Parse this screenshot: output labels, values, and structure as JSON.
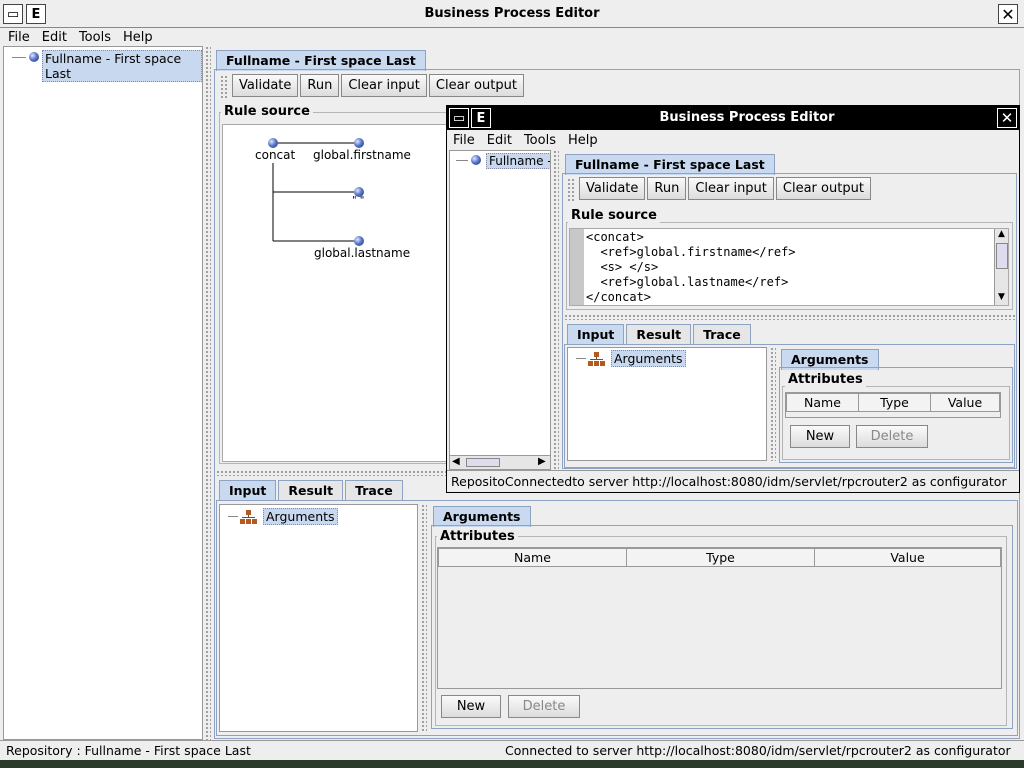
{
  "main": {
    "title": "Business Process Editor",
    "menu": [
      {
        "label": "File"
      },
      {
        "label": "Edit"
      },
      {
        "label": "Tools"
      },
      {
        "label": "Help"
      }
    ],
    "tree_root": "Fullname - First space Last",
    "doc_tab": "Fullname - First space Last",
    "toolbar": {
      "validate": "Validate",
      "run": "Run",
      "clear_input": "Clear input",
      "clear_output": "Clear output"
    },
    "rule_source_title": "Rule source",
    "diagram": {
      "root": "concat",
      "children": [
        "global.firstname",
        "\" \"",
        "global.lastname"
      ]
    },
    "io_tabs": [
      "Input",
      "Result",
      "Trace"
    ],
    "args_tree": "Arguments",
    "args_tab": "Arguments",
    "attributes_title": "Attributes",
    "columns": [
      "Name",
      "Type",
      "Value"
    ],
    "new_label": "New",
    "delete_label": "Delete",
    "status_left": "Repository : Fullname - First space Last",
    "status_right": "Connected to server http://localhost:8080/idm/servlet/rpcrouter2 as configurator"
  },
  "popup": {
    "title": "Business Process Editor",
    "menu": [
      {
        "label": "File"
      },
      {
        "label": "Edit"
      },
      {
        "label": "Tools"
      },
      {
        "label": "Help"
      }
    ],
    "tree_item": "Fullname -",
    "doc_tab": "Fullname - First space Last",
    "toolbar": {
      "validate": "Validate",
      "run": "Run",
      "clear_input": "Clear input",
      "clear_output": "Clear output"
    },
    "rule_source_title": "Rule source",
    "code_lines": [
      "<concat>",
      "  <ref>global.firstname</ref>",
      "  <s> </s>",
      "  <ref>global.lastname</ref>",
      "</concat>"
    ],
    "io_tabs": [
      "Input",
      "Result",
      "Trace"
    ],
    "args_tree": "Arguments",
    "args_tab": "Arguments",
    "attributes_title": "Attributes",
    "columns": [
      "Name",
      "Type",
      "Value"
    ],
    "new_label": "New",
    "delete_label": "Delete",
    "status_text": "RepositoConnectedto server http://localhost:8080/idm/servlet/rpcrouter2 as configurator"
  }
}
